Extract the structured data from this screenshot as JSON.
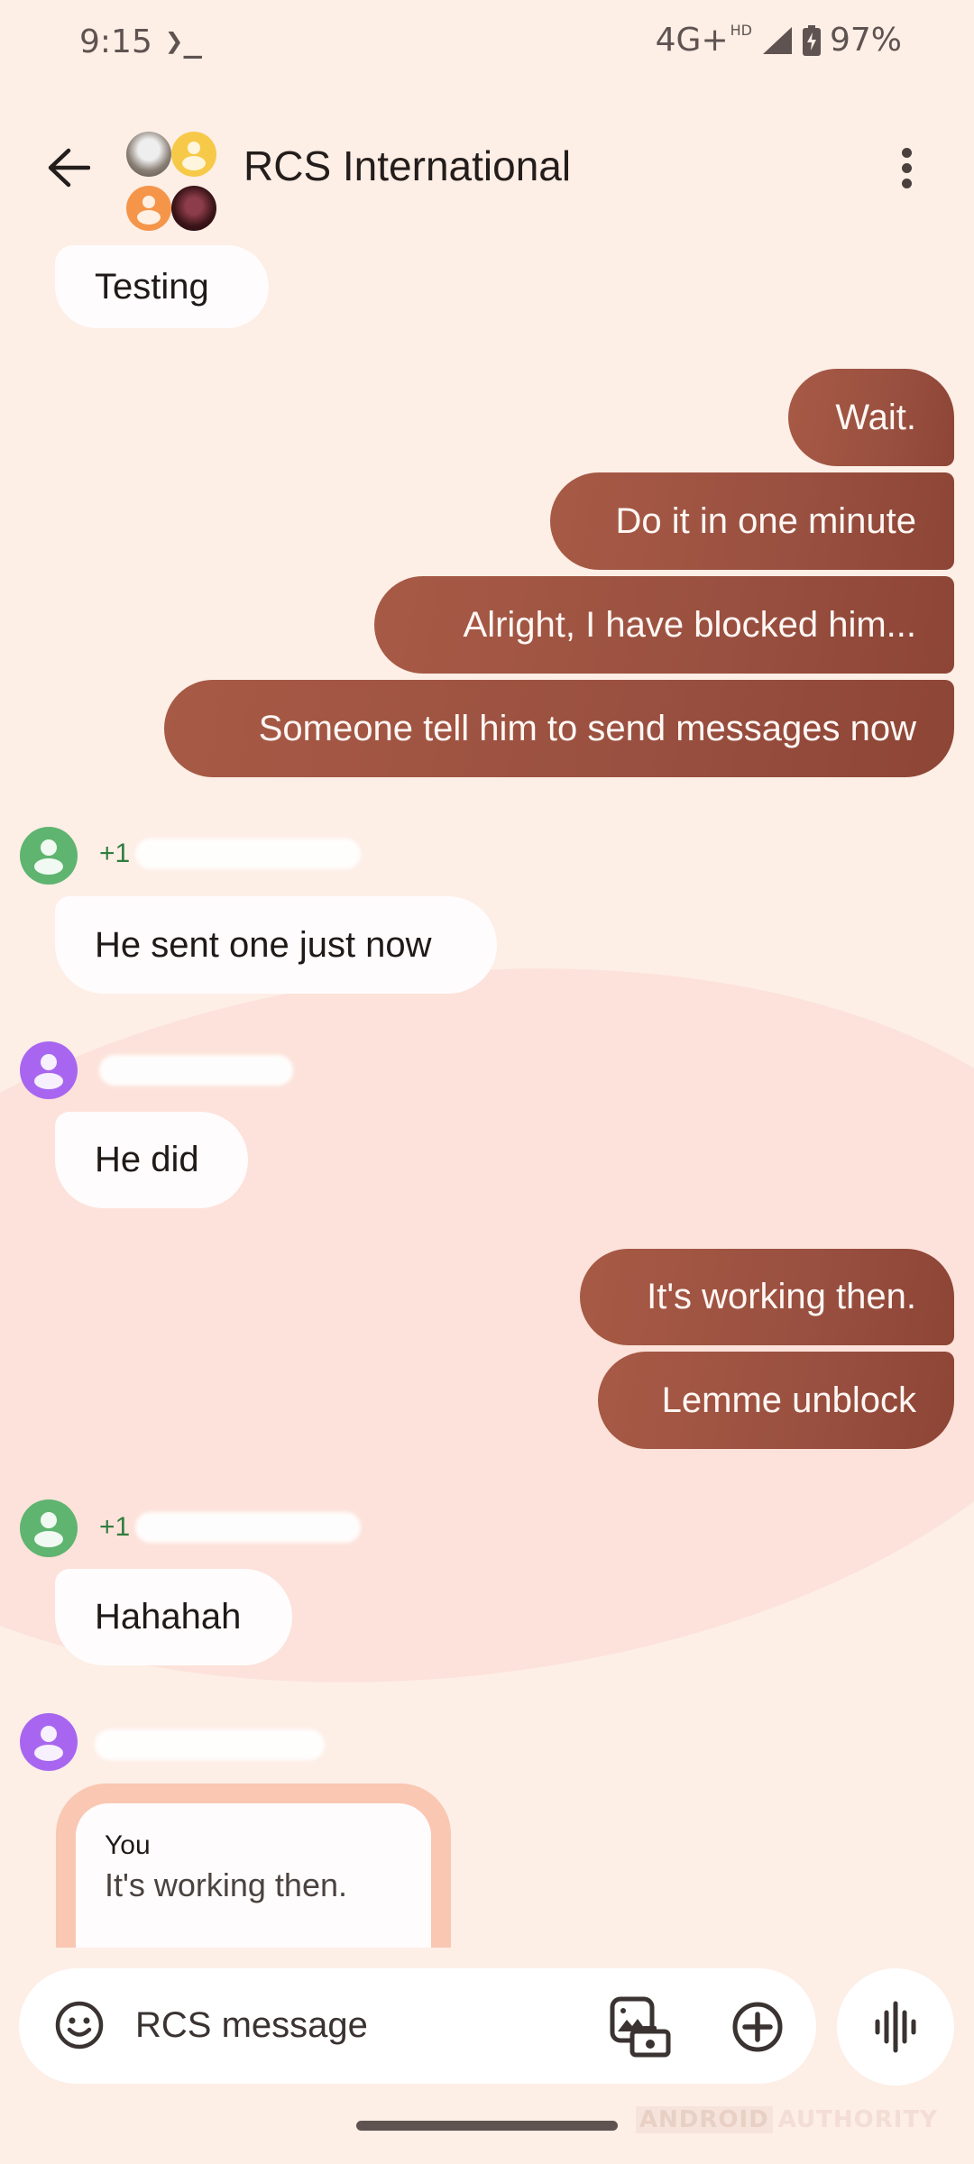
{
  "status_bar": {
    "time": "9:15",
    "terminal_glyph": "❯_",
    "network": "4G+",
    "network_badge": "HD",
    "battery_percent": "97%"
  },
  "app_bar": {
    "title": "RCS International",
    "back_icon": "arrow-left-icon",
    "menu_icon": "more-vert-icon",
    "group_avatars": [
      {
        "type": "photo",
        "color": "#8A7F75"
      },
      {
        "type": "placeholder",
        "color": "#F7C948"
      },
      {
        "type": "placeholder",
        "color": "#F5954A"
      },
      {
        "type": "photo",
        "color": "#3A1418"
      }
    ]
  },
  "colors": {
    "background": "#FDEEE6",
    "incoming_bubble": "#FFFCFD",
    "outgoing_bubble_start": "#A75A45",
    "outgoing_bubble_end": "#8D4535",
    "sender_green": "#5FB470",
    "sender_purple": "#A866F0",
    "quote_frame": "#F9C7B2"
  },
  "messages": [
    {
      "direction": "in",
      "text": "Testing"
    },
    {
      "direction": "out",
      "text": "Wait."
    },
    {
      "direction": "out",
      "text": "Do it in one minute"
    },
    {
      "direction": "out",
      "text": "Alright, I have blocked him..."
    },
    {
      "direction": "out",
      "text": "Someone tell him to send messages now"
    },
    {
      "direction": "in",
      "sender": {
        "name_prefix": "+1",
        "name_redacted": true,
        "avatar_color": "green"
      },
      "text": "He sent one just now"
    },
    {
      "direction": "in",
      "sender": {
        "name_prefix": "",
        "name_redacted": true,
        "avatar_color": "purple"
      },
      "text": "He did"
    },
    {
      "direction": "out",
      "text": "It's working then."
    },
    {
      "direction": "out",
      "text": "Lemme unblock"
    },
    {
      "direction": "in",
      "sender": {
        "name_prefix": "+1",
        "name_redacted": true,
        "avatar_color": "green"
      },
      "text": "Hahahah"
    },
    {
      "direction": "in",
      "sender": {
        "name_prefix": "",
        "name_redacted": true,
        "avatar_color": "purple"
      },
      "quote": {
        "author": "You",
        "text": "It's working then."
      }
    }
  ],
  "compose": {
    "placeholder": "RCS message",
    "value": "",
    "emoji_icon": "emoji-icon",
    "gallery_icon": "gallery-camera-icon",
    "add_icon": "add-circle-icon",
    "voice_icon": "voice-waveform-icon"
  },
  "watermark": {
    "part1": "ANDROID",
    "part2": "AUTHORITY"
  }
}
